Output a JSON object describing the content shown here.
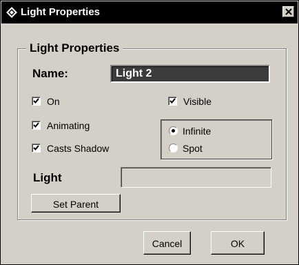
{
  "window": {
    "title": "Light Properties",
    "icon": "diamond-cube-icon",
    "close_icon": "close-icon"
  },
  "group": {
    "title": "Light Properties"
  },
  "name": {
    "label": "Name:",
    "value": "Light 2"
  },
  "checkboxes": {
    "on": {
      "label": "On",
      "checked": true
    },
    "visible": {
      "label": "Visible",
      "checked": true
    },
    "animating": {
      "label": "Animating",
      "checked": true
    },
    "casts_shadow": {
      "label": "Casts Shadow",
      "checked": true
    }
  },
  "light_type": {
    "options": [
      {
        "label": "Infinite",
        "selected": true
      },
      {
        "label": "Spot",
        "selected": false
      }
    ]
  },
  "light": {
    "label": "Light",
    "value": ""
  },
  "buttons": {
    "set_parent": "Set Parent",
    "cancel": "Cancel",
    "ok": "OK"
  }
}
